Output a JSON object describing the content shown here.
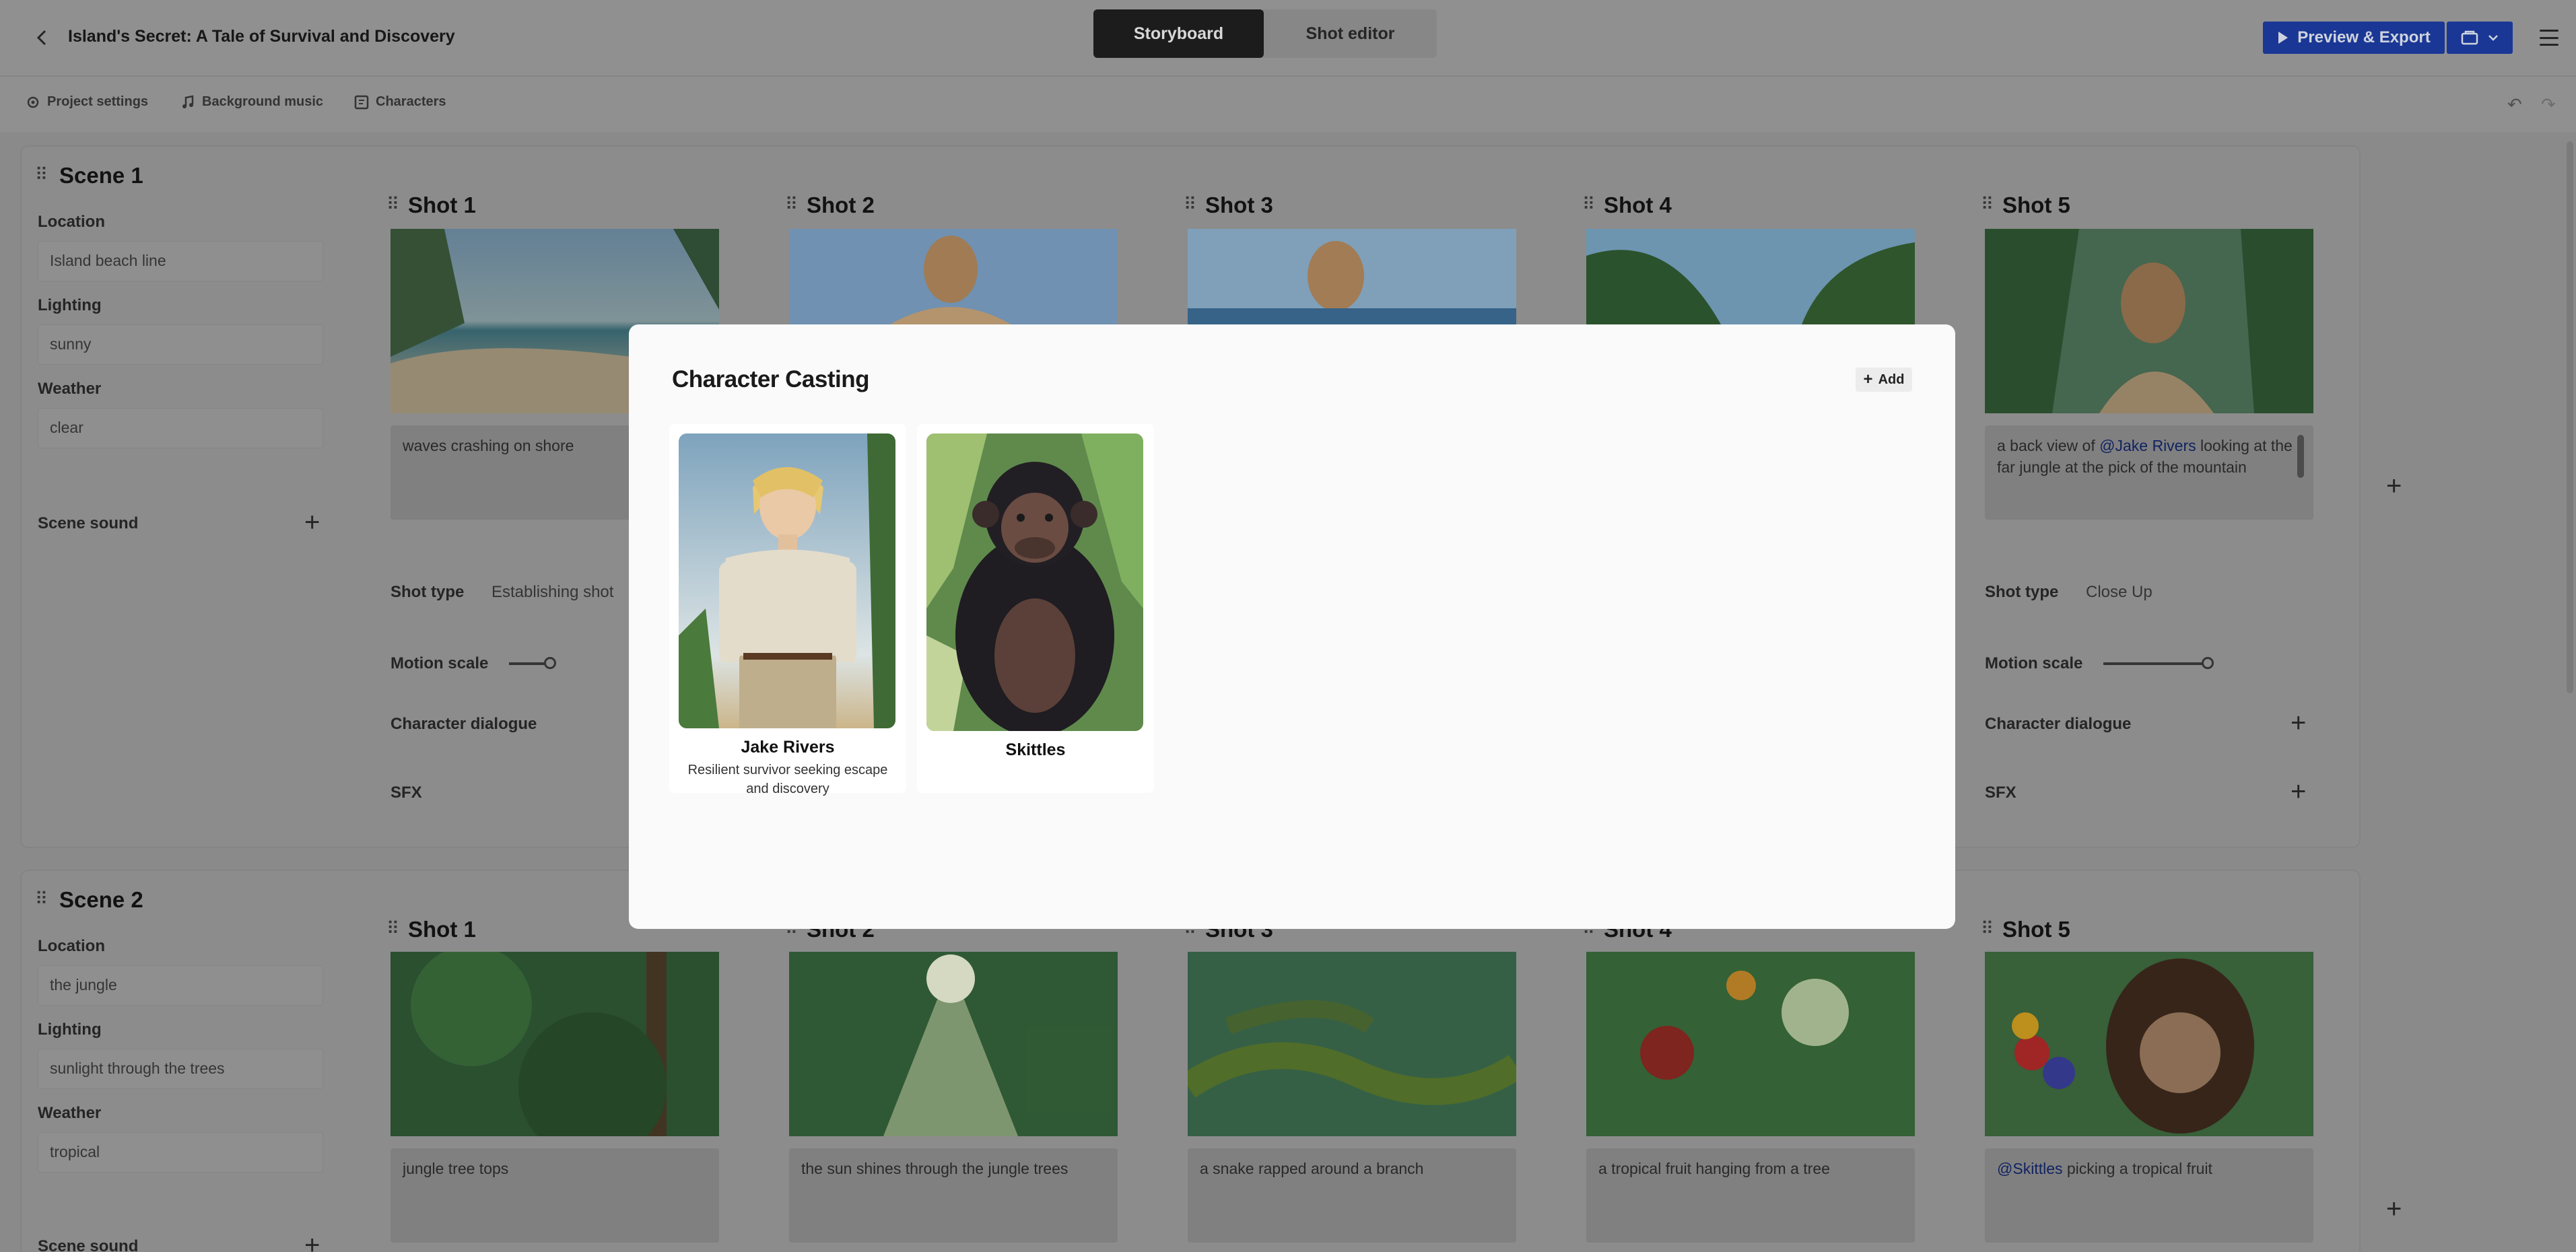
{
  "header": {
    "title": "Island's Secret: A Tale of Survival and Discovery",
    "tabs": [
      {
        "label": "Storyboard",
        "active": true
      },
      {
        "label": "Shot editor",
        "active": false
      }
    ],
    "preview_label": "Preview & Export",
    "accent_color": "#1d3ea6"
  },
  "toolbar": {
    "project_settings": "Project settings",
    "background_music": "Background music",
    "characters": "Characters"
  },
  "scenes": [
    {
      "title": "Scene 1",
      "location_label": "Location",
      "location": "Island beach line",
      "lighting_label": "Lighting",
      "lighting": "sunny",
      "weather_label": "Weather",
      "weather": "clear",
      "sound_label": "Scene sound",
      "shots": [
        {
          "title": "Shot 1",
          "desc": "waves crashing on shore",
          "shot_type_label": "Shot type",
          "shot_type": "Establishing shot",
          "motion_label": "Motion scale",
          "motion": 0.4,
          "dialogue_label": "Character dialogue",
          "sfx_label": "SFX"
        },
        {
          "title": "Shot 2"
        },
        {
          "title": "Shot 3"
        },
        {
          "title": "Shot 4"
        },
        {
          "title": "Shot 5",
          "desc_pre": "a back view of ",
          "desc_mention": "@Jake Rivers",
          "desc_post": " looking at the far jungle at the pick of the mountain",
          "shot_type_label": "Shot type",
          "shot_type": "Close Up",
          "motion_label": "Motion scale",
          "motion": 0.6,
          "dialogue_label": "Character dialogue",
          "sfx_label": "SFX"
        }
      ]
    },
    {
      "title": "Scene 2",
      "location_label": "Location",
      "location": "the jungle",
      "lighting_label": "Lighting",
      "lighting": "sunlight through the trees",
      "weather_label": "Weather",
      "weather": "tropical",
      "sound_label": "Scene sound",
      "shots": [
        {
          "title": "Shot 1",
          "desc": "jungle tree tops"
        },
        {
          "title": "Shot 2",
          "desc": "the sun shines through the jungle trees"
        },
        {
          "title": "Shot 3",
          "desc": "a snake rapped around a branch"
        },
        {
          "title": "Shot 4",
          "desc": "a tropical fruit hanging from a tree"
        },
        {
          "title": "Shot 5",
          "desc_mention": "@Skittles",
          "desc_post": " picking a tropical fruit"
        }
      ]
    }
  ],
  "modal": {
    "title": "Character Casting",
    "add_label": "Add",
    "characters": [
      {
        "name": "Jake Rivers",
        "desc": "Resilient survivor seeking escape and discovery"
      },
      {
        "name": "Skittles",
        "desc": ""
      }
    ]
  }
}
